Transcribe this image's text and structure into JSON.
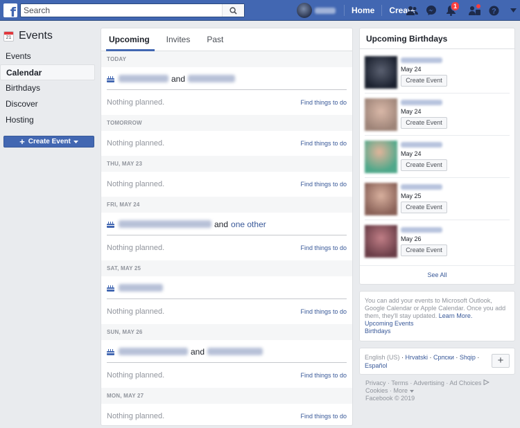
{
  "topbar": {
    "search_placeholder": "Search",
    "nav": [
      "Home",
      "Create"
    ],
    "notifications_count": "1",
    "brand_color": "#4267b2"
  },
  "sidebar": {
    "title": "Events",
    "calendar_day": "21",
    "items": [
      {
        "label": "Events",
        "active": false
      },
      {
        "label": "Calendar",
        "active": true
      },
      {
        "label": "Birthdays",
        "active": false
      },
      {
        "label": "Discover",
        "active": false
      },
      {
        "label": "Hosting",
        "active": false
      }
    ],
    "create_label": "Create Event"
  },
  "main": {
    "tabs": [
      {
        "label": "Upcoming",
        "active": true
      },
      {
        "label": "Invites",
        "active": false
      },
      {
        "label": "Past",
        "active": false
      }
    ],
    "nothing_planned": "Nothing planned.",
    "find_things": "Find things to do",
    "and": "and",
    "one_other": "one other",
    "days": [
      {
        "header": "TODAY",
        "birthday": "pair"
      },
      {
        "header": "TOMORROW",
        "birthday": "none"
      },
      {
        "header": "THU, MAY 23",
        "birthday": "none"
      },
      {
        "header": "FRI, MAY 24",
        "birthday": "pair-other"
      },
      {
        "header": "SAT, MAY 25",
        "birthday": "single"
      },
      {
        "header": "SUN, MAY 26",
        "birthday": "pair"
      },
      {
        "header": "MON, MAY 27",
        "birthday": "none"
      }
    ]
  },
  "birthdays": {
    "title": "Upcoming Birthdays",
    "button_label": "Create Event",
    "items": [
      {
        "date": "May 24"
      },
      {
        "date": "May 24"
      },
      {
        "date": "May 24"
      },
      {
        "date": "May 25"
      },
      {
        "date": "May 26"
      }
    ],
    "see_all": "See All"
  },
  "calendar_info": {
    "text": "You can add your events to Microsoft Outlook, Google Calendar or Apple Calendar. Once you add them, they'll stay updated.",
    "learn_more": "Learn More.",
    "link1": "Upcoming Events",
    "link2": "Birthdays"
  },
  "languages": {
    "current": "English (US)",
    "others": [
      "Hrvatski",
      "Српски",
      "Shqip",
      "Español"
    ]
  },
  "footer": {
    "line1": "Privacy · Terms · Advertising · Ad Choices",
    "line2": "Cookies · More",
    "copyright": "Facebook © 2019"
  }
}
